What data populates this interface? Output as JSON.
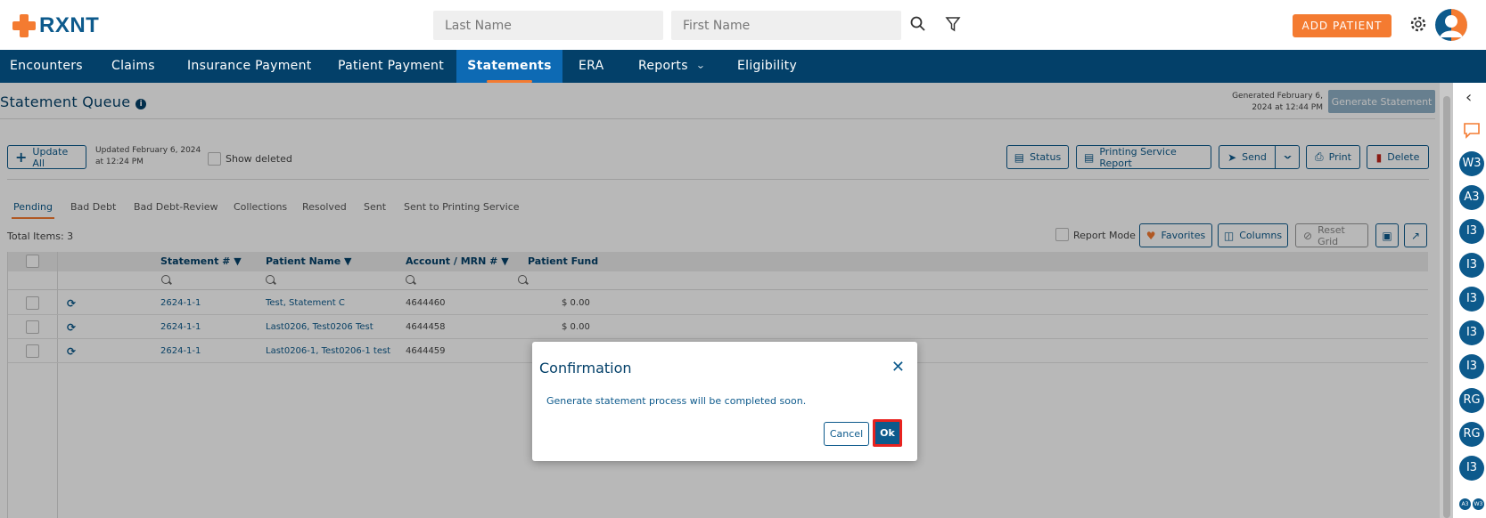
{
  "header": {
    "logo_text": "RXNT",
    "last_name_placeholder": "Last Name",
    "first_name_placeholder": "First Name",
    "add_patient_label": "ADD PATIENT"
  },
  "nav": {
    "items": [
      {
        "label": "Encounters"
      },
      {
        "label": "Claims"
      },
      {
        "label": "Insurance Payment"
      },
      {
        "label": "Patient Payment"
      },
      {
        "label": "Statements"
      },
      {
        "label": "ERA"
      },
      {
        "label": "Reports"
      },
      {
        "label": "Eligibility"
      }
    ],
    "active": "Statements"
  },
  "page": {
    "title": "Statement Queue",
    "generated_line1": "Generated February 6,",
    "generated_line2": "2024 at 12:44 PM",
    "generate_button": "Generate Statement"
  },
  "toolbar": {
    "update_all": "Update All",
    "updated_line1": "Updated February 6, 2024",
    "updated_line2": "at 12:24 PM",
    "show_deleted": "Show deleted",
    "status": "Status",
    "printing_report": "Printing Service Report",
    "send": "Send",
    "print": "Print",
    "delete": "Delete"
  },
  "tabs": [
    "Pending",
    "Bad Debt",
    "Bad Debt-Review",
    "Collections",
    "Resolved",
    "Sent",
    "Sent to Printing Service"
  ],
  "grid_toolbar": {
    "total_items": "Total Items: 3",
    "report_mode": "Report Mode",
    "favorites": "Favorites",
    "columns": "Columns",
    "reset_grid": "Reset Grid"
  },
  "grid": {
    "headers": [
      "Statement #",
      "Patient Name",
      "Account / MRN #",
      "Patient Fund"
    ],
    "rows": [
      {
        "statement": "2624-1-1",
        "patient": "Test, Statement C",
        "account": "4644460",
        "fund": "$ 0.00"
      },
      {
        "statement": "2624-1-1",
        "patient": "Last0206, Test0206 Test",
        "account": "4644458",
        "fund": "$ 0.00"
      },
      {
        "statement": "2624-1-1",
        "patient": "Last0206-1, Test0206-1 test",
        "account": "4644459",
        "fund": ""
      }
    ]
  },
  "rail": {
    "badges": [
      "W3",
      "A3",
      "I3",
      "I3",
      "I3",
      "I3",
      "I3",
      "RG",
      "RG",
      "I3"
    ],
    "mini_badges": [
      "A3",
      "W3"
    ]
  },
  "modal": {
    "title": "Confirmation",
    "message": "Generate statement process will be completed soon.",
    "cancel": "Cancel",
    "ok": "Ok"
  },
  "colors": {
    "brand_orange": "#f47b31",
    "brand_navy": "#034069",
    "brand_blue": "#0d5a8c",
    "active_tab": "#0d6ab4",
    "highlight_red": "#e8231f"
  }
}
